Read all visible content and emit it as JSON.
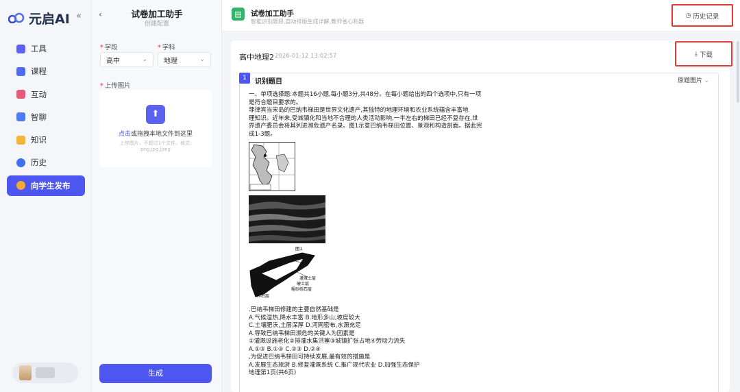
{
  "sidebar": {
    "logo_text": "元启AI",
    "collapse_glyph": "«",
    "items": [
      {
        "label": "工具",
        "icon": "wrench-icon",
        "color": "#5b63f0"
      },
      {
        "label": "课程",
        "icon": "video-icon",
        "color": "#4f6cf0"
      },
      {
        "label": "互动",
        "icon": "interact-icon",
        "color": "#e25b7a"
      },
      {
        "label": "智聊",
        "icon": "chat-icon",
        "color": "#4d7cf0"
      },
      {
        "label": "知识",
        "icon": "folder-icon",
        "color": "#f2b43a"
      },
      {
        "label": "历史",
        "icon": "history-icon",
        "color": "#3e6ff0"
      },
      {
        "label": "向学生发布",
        "icon": "send-icon",
        "color": "#f2a93a",
        "active": true
      }
    ]
  },
  "form": {
    "back_glyph": "‹",
    "title": "试卷加工助手",
    "subtitle": "创建配置",
    "stage_label": "学段",
    "stage_value": "高中",
    "subject_label": "学科",
    "subject_value": "地理",
    "upload_label": "上传图片",
    "upload_click": "点击",
    "upload_drag": "或拖拽本地文件到这里",
    "upload_hint1": "上传图片，不超过1个文件，格式:",
    "upload_hint2": "png,jpg,jpeg",
    "generate_label": "生成"
  },
  "header": {
    "app_title": "试卷加工助手",
    "app_desc": "智能识别题目,自动排版生成详解,教师省心利器",
    "history_label": "历史记录"
  },
  "doc": {
    "title": "高中地理2",
    "time": "2026-01-12 13:02:57",
    "download_label": "下载",
    "section_index": "1",
    "section_title": "识别题目",
    "original_pic_label": "原题图片",
    "lines_top": [
      "一、单项选择题:本题共16小题,每小题3分,共48分。在每小题给出的四个选项中,只有一项",
      "是符合题目要求的。",
      "菲律宾当宋岛的巴纳韦梯田是世界文化遗产,其独特的地理环境和农业系统蕴含丰富地",
      "理知识。近年来,受城镇化和当地不合理的人类活动影响,一半左右的梯田已经不复存在,世",
      "界遗产委员会将其列进濒危遗产名录。图1示意巴纳韦梯田位置、景观和构造剖面。据此完",
      "成1-3题。"
    ],
    "lines_bottom": [
      ".巴纳韦梯田修建的主要自然基础是",
      "A.气候湿热,降水丰富 B.地形多山,坡度较大",
      "C.土壤肥沃,土层深厚 D.河网密布,水源充足",
      "A.导致巴纳韦梯田濒危的关键人为因素是",
      "①灌溉设施老化②排灌水集洪塞③城镇扩张占地④劳动力流失",
      "A.①③ B.①④ C.②③ D.②④",
      ",为促进巴纳韦梯田可持续发展,最有效的措施是",
      "A.发展生态旅游 B.修复灌溉系统 C.推广现代农业 D.加强生态保护",
      "地理第1页(共6页)"
    ],
    "figure_caption": "图1",
    "figure_labels": [
      "排水口",
      "石墙",
      "灌溉土层",
      "硬土层",
      "粗砂砾石层",
      "碎石层"
    ]
  }
}
